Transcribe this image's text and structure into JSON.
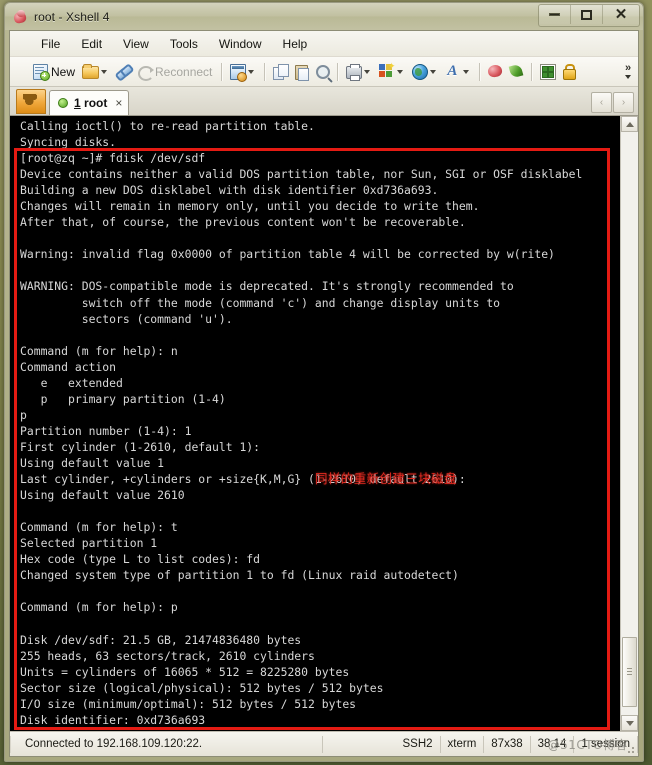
{
  "window": {
    "title": "root - Xshell 4",
    "icon": "xshell-logo-icon",
    "minimize_label": "Minimize",
    "maximize_label": "Maximize",
    "close_label": "Close"
  },
  "menubar": {
    "items": [
      {
        "label": "File"
      },
      {
        "label": "Edit"
      },
      {
        "label": "View"
      },
      {
        "label": "Tools"
      },
      {
        "label": "Window"
      },
      {
        "label": "Help"
      }
    ]
  },
  "toolbar": {
    "new_label": "New",
    "reconnect_label": "Reconnect",
    "overflow_label": "»",
    "icons": [
      "new-session-icon",
      "open-folder-icon",
      "connect-link-icon",
      "reconnect-icon",
      "session-manager-icon",
      "copy-icon",
      "paste-icon",
      "find-icon",
      "print-icon",
      "color-scheme-icon",
      "web-browser-icon",
      "font-icon",
      "xshell-icon",
      "xftp-icon",
      "arrange-layout-icon",
      "lock-icon"
    ]
  },
  "tabs": {
    "new_tab_label": "New Tab",
    "items": [
      {
        "label": "1 root",
        "index": "1",
        "name": "root",
        "close_label": "×",
        "active": true
      }
    ],
    "nav_prev": "‹",
    "nav_next": "›"
  },
  "terminal": {
    "lines": [
      "Calling ioctl() to re-read partition table.",
      "Syncing disks.",
      "[root@zq ~]# fdisk /dev/sdf",
      "Device contains neither a valid DOS partition table, nor Sun, SGI or OSF disklabel",
      "Building a new DOS disklabel with disk identifier 0xd736a693.",
      "Changes will remain in memory only, until you decide to write them.",
      "After that, of course, the previous content won't be recoverable.",
      "",
      "Warning: invalid flag 0x0000 of partition table 4 will be corrected by w(rite)",
      "",
      "WARNING: DOS-compatible mode is deprecated. It's strongly recommended to",
      "         switch off the mode (command 'c') and change display units to",
      "         sectors (command 'u').",
      "",
      "Command (m for help): n",
      "Command action",
      "   e   extended",
      "   p   primary partition (1-4)",
      "p",
      "Partition number (1-4): 1",
      "First cylinder (1-2610, default 1):",
      "Using default value 1",
      "Last cylinder, +cylinders or +size{K,M,G} (1-2610, default 2610):",
      "Using default value 2610",
      "",
      "Command (m for help): t",
      "Selected partition 1",
      "Hex code (type L to list codes): fd",
      "Changed system type of partition 1 to fd (Linux raid autodetect)",
      "",
      "Command (m for help): p",
      "",
      "Disk /dev/sdf: 21.5 GB, 21474836480 bytes",
      "255 heads, 63 sectors/track, 2610 cylinders",
      "Units = cylinders of 16065 * 512 = 8225280 bytes",
      "Sector size (logical/physical): 512 bytes / 512 bytes",
      "I/O size (minimum/optimal): 512 bytes / 512 bytes",
      "Disk identifier: 0xd736a693"
    ],
    "annotation": "同样的重新创建三块磁盘",
    "annotation_color": "#e02a20",
    "highlight_box_color": "#e41b13",
    "background_color": "#000000",
    "text_color": "#d8d8d8"
  },
  "statusbar": {
    "connection": "Connected to 192.168.109.120:22.",
    "protocol": "SSH2",
    "term_type": "xterm",
    "size": "87x38",
    "cursor": "38,14",
    "sessions": "1 session",
    "watermark": "@51CTO博客"
  }
}
